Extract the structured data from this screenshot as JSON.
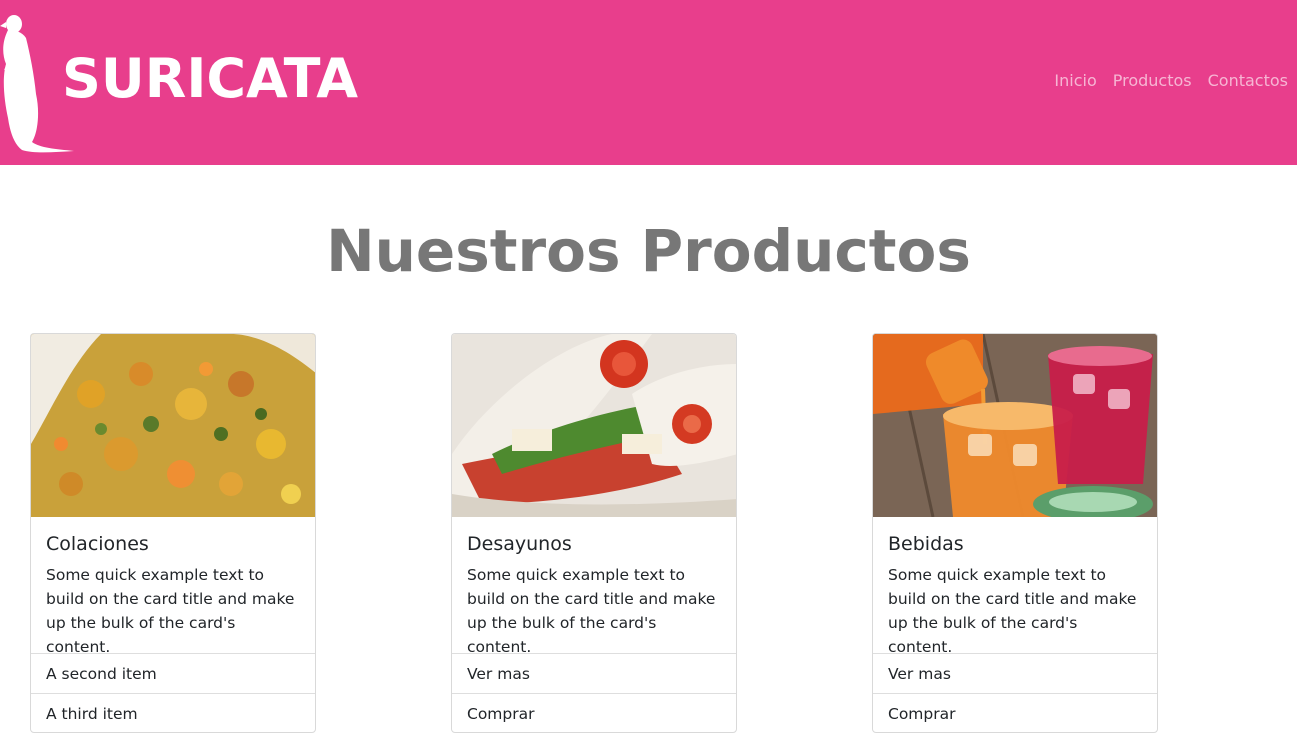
{
  "navbar": {
    "brand": "SURICATA",
    "background": "#e83e8c",
    "links": [
      "Inicio",
      "Productos",
      "Contactos"
    ]
  },
  "page_title": "Nuestros Productos",
  "cards": [
    {
      "title": "Colaciones",
      "text": "Some quick example text to build on the card title and make up the bulk of the card's content.",
      "items": [
        "A second item",
        "A third item"
      ]
    },
    {
      "title": "Desayunos",
      "text": "Some quick example text to build on the card title and make up the bulk of the card's content.",
      "items": [
        "Ver mas",
        "Comprar"
      ]
    },
    {
      "title": "Bebidas",
      "text": "Some quick example text to build on the card title and make up the bulk of the card's content.",
      "items": [
        "Ver mas",
        "Comprar"
      ]
    }
  ]
}
